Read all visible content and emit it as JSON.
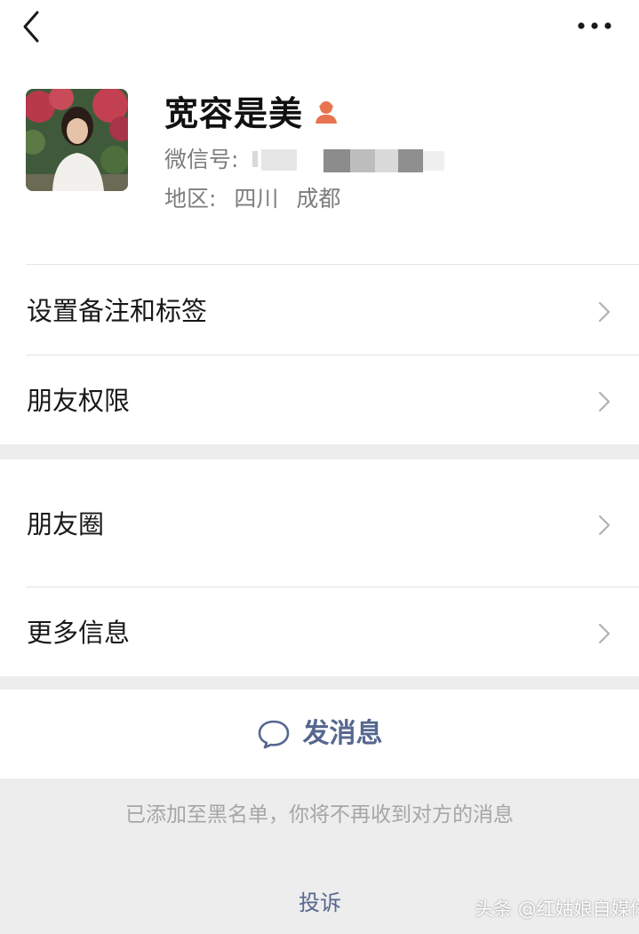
{
  "profile": {
    "name": "宽容是美",
    "wechat_id_label": "微信号:",
    "region_label": "地区:",
    "region_province": "四川",
    "region_city": "成都",
    "gender_icon": "female-icon",
    "gender_color": "#e8734f"
  },
  "menu": {
    "items": [
      {
        "label": "设置备注和标签"
      },
      {
        "label": "朋友权限"
      },
      {
        "label": "朋友圈"
      },
      {
        "label": "更多信息"
      }
    ]
  },
  "actions": {
    "send_message_label": "发消息",
    "send_icon": "chat-bubble-icon"
  },
  "blacklist_notice": "已添加至黑名单，你将不再收到对方的消息",
  "complain_label": "投诉",
  "watermark": "头条 @红姑娘自媒体",
  "colors": {
    "link_blue": "#56678f",
    "background_gray": "#ededed",
    "secondary_text": "#7d7d7d"
  }
}
